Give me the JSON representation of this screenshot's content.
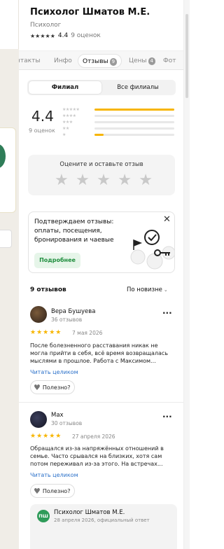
{
  "org": {
    "name": "Психолог Шматов М.Е.",
    "category": "Психолог",
    "rating": "4.4",
    "rating_count": "9 оценок"
  },
  "tabs": [
    {
      "label": "нтакты"
    },
    {
      "label": "Инфо"
    },
    {
      "label": "Отзывы",
      "badge": "9",
      "active": true
    },
    {
      "label": "Цены",
      "badge": "4"
    },
    {
      "label": "Фот"
    }
  ],
  "branch_toggle": {
    "branch": "Филиал",
    "all": "Все филиалы"
  },
  "summary": {
    "rating": "4.4",
    "count": "9 оценок",
    "distribution": [
      {
        "stars": "5",
        "fraction": 1.0
      },
      {
        "stars": "4",
        "fraction": 0.0
      },
      {
        "stars": "3",
        "fraction": 0.0
      },
      {
        "stars": "2",
        "fraction": 0.0
      },
      {
        "stars": "1",
        "fraction": 0.11
      }
    ]
  },
  "rate_box": {
    "title": "Оцените и оставьте отзыв"
  },
  "promo": {
    "text": "Подтверждаем отзывы: оплаты, посещения, бронирования и чаевые",
    "button": "Подробнее"
  },
  "reviews_header": {
    "count": "9 отзывов",
    "sort": "По новизне"
  },
  "reviews": [
    {
      "author": "Вера Бушуева",
      "author_sub": "36 отзывов",
      "stars": 5,
      "date": "7 мая 2026",
      "text": "После болезненного расставания никак не могла прийти в себя, всё время возвращалась мыслями в прошлое. Работа с Максимом...",
      "more_link": "Читать целиком",
      "useful": "Полезно?"
    },
    {
      "author": "Max",
      "author_sub": "30 отзывов",
      "stars": 5,
      "date": "27 апреля 2026",
      "text": "Обращался из-за напряжённых отношений в семье. Часто срывался на близких, хотя сам потом переживал из-за этого. На встречах...",
      "more_link": "Читать целиком",
      "useful": "Полезно?"
    }
  ],
  "reply": {
    "logo": "ПШ",
    "name": "Психолог Шматов М.Е.",
    "sub": "28 апреля 2026, официальный ответ"
  },
  "colors": {
    "star": "#f7b500",
    "accent_green": "#1e8d3d",
    "link": "#2a70c9"
  }
}
